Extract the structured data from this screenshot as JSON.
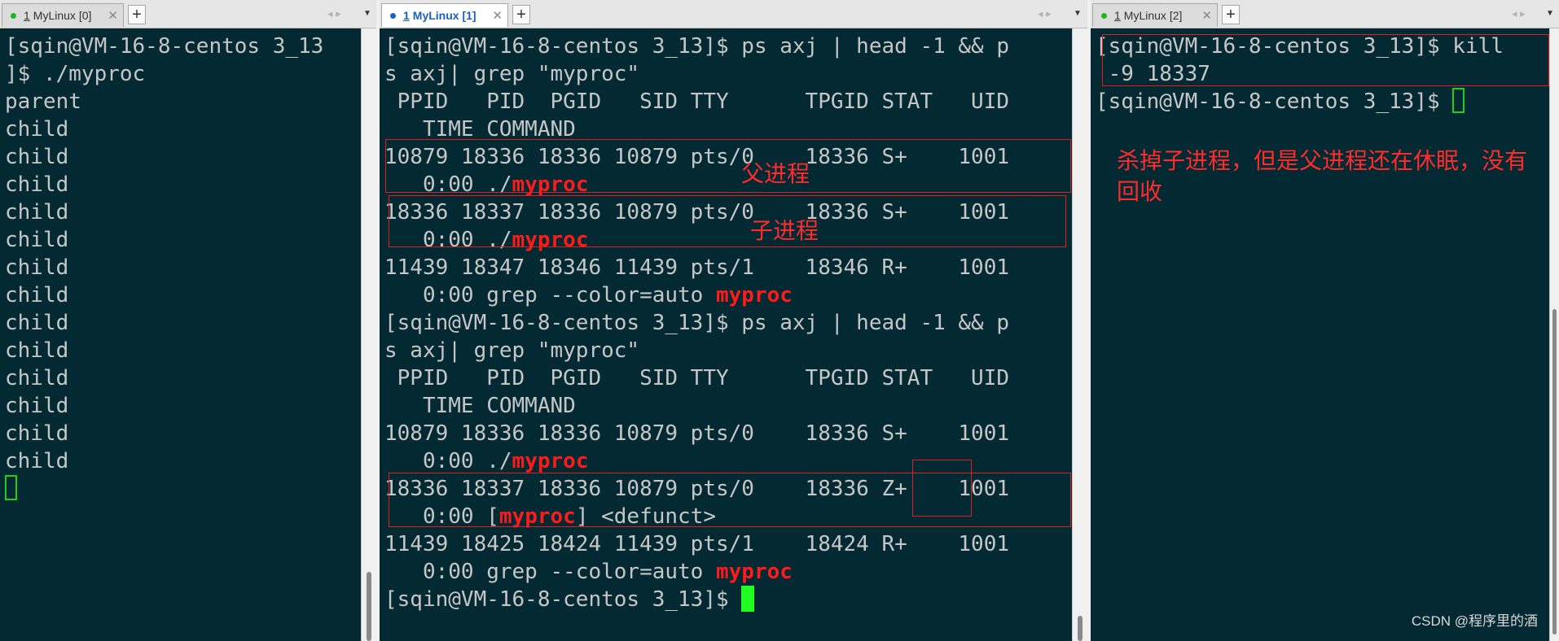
{
  "tabs": [
    {
      "num": "1",
      "label": "MyLinux [0]"
    },
    {
      "num": "1",
      "label": "MyLinux [1]"
    },
    {
      "num": "1",
      "label": "MyLinux [2]"
    }
  ],
  "terminal_left": [
    "[sqin@VM-16-8-centos 3_13",
    "]$ ./myproc",
    "parent",
    "child",
    "child",
    "child",
    "child",
    "child",
    "child",
    "child",
    "child",
    "child",
    "child",
    "child",
    "child",
    "child"
  ],
  "terminal_middle": {
    "cmd1": "[sqin@VM-16-8-centos 3_13]$ ps axj | head -1 && p",
    "cmd2": "s axj| grep \"myproc\"",
    "hdr1": " PPID   PID  PGID   SID TTY      TPGID STAT   UID",
    "hdr2": "   TIME COMMAND",
    "r1a": "10879 18336 18336 10879 pts/0    18336 S+    1001",
    "r1b_pre": "   0:00 ./",
    "r2a": "18336 18337 18336 10879 pts/0    18336 S+    1001",
    "r2b_pre": "   0:00 ./",
    "r3a": "11439 18347 18346 11439 pts/1    18346 R+    1001",
    "r3b_pre": "   0:00 grep --color=auto ",
    "r4a": "10879 18336 18336 10879 pts/0    18336 S+    1001",
    "r4b_pre": "   0:00 ./",
    "r5a": "18336 18337 18336 10879 pts/0    18336 Z+    1001",
    "r5b_pre": "   0:00 [",
    "r5b_post": "] <defunct>",
    "r6a": "11439 18425 18424 11439 pts/1    18424 R+    1001",
    "r6b_pre": "   0:00 grep --color=auto ",
    "prompt": "[sqin@VM-16-8-centos 3_13]$ ",
    "highlight": "myproc"
  },
  "terminal_right": {
    "line1": "[sqin@VM-16-8-centos 3_13]$ kill",
    "line2": " -9 18337",
    "prompt": "[sqin@VM-16-8-centos 3_13]$ "
  },
  "annotations": {
    "parent": "父进程",
    "child": "子进程",
    "note": "杀掉子进程，但是父进程还在休眠，没有回收"
  },
  "watermark": "CSDN @程序里的酒",
  "colors": {
    "terminal_bg": "#032a33",
    "terminal_fg": "#c6c6c6",
    "highlight": "#ff1a1a",
    "cursor": "#20ff20",
    "active_tab": "#1a5fc8"
  }
}
